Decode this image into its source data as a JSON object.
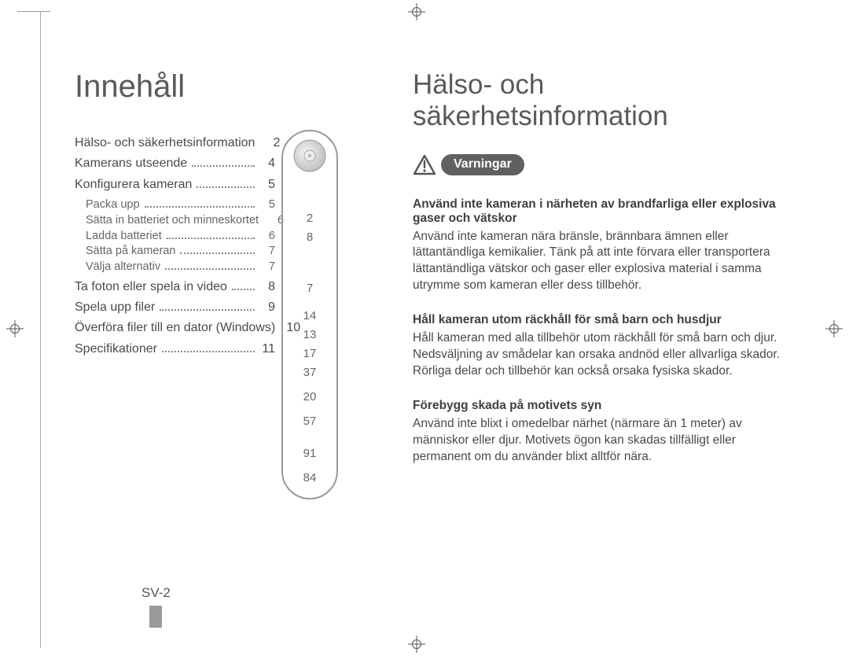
{
  "toc": {
    "title": "Innehåll",
    "items": [
      {
        "label": "Hälso- och säkerhetsinformation",
        "page": "2",
        "sub": false
      },
      {
        "label": "Kamerans utseende",
        "page": "4",
        "sub": false
      },
      {
        "label": "Konfigurera kameran",
        "page": "5",
        "sub": false
      },
      {
        "label": "Packa upp",
        "page": "5",
        "sub": true
      },
      {
        "label": "Sätta in batteriet och minneskortet",
        "page": "6",
        "sub": true
      },
      {
        "label": "Ladda batteriet",
        "page": "6",
        "sub": true
      },
      {
        "label": "Sätta på kameran",
        "page": "7",
        "sub": true
      },
      {
        "label": "Välja alternativ",
        "page": "7",
        "sub": true
      },
      {
        "label": "Ta foton eller spela in video",
        "page": "8",
        "sub": false
      },
      {
        "label": "Spela upp filer",
        "page": "9",
        "sub": false
      },
      {
        "label": "Överföra filer till en dator (Windows)",
        "page": "10",
        "sub": false
      },
      {
        "label": "Specifikationer",
        "page": "11",
        "sub": false
      }
    ]
  },
  "thumb_index": [
    "2",
    "8",
    "7",
    "14",
    "13",
    "17",
    "37",
    "20",
    "57",
    "91",
    "84"
  ],
  "safety": {
    "title": "Hälso- och säkerhetsinformation",
    "badge_label": "Varningar",
    "blocks": [
      {
        "title": "Använd inte kameran i närheten av brandfarliga eller explosiva gaser och vätskor",
        "body": "Använd inte kameran nära bränsle, brännbara ämnen eller lättantändliga kemikalier. Tänk på att inte förvara eller transportera lättantändliga vätskor och gaser eller explosiva material i samma utrymme som kameran eller dess tillbehör."
      },
      {
        "title": "Håll kameran utom räckhåll för små barn och husdjur",
        "body": "Håll kameran med alla tillbehör utom räckhåll för små barn och djur. Nedsväljning av smådelar kan orsaka andnöd eller allvarliga skador. Rörliga delar och tillbehör kan också orsaka fysiska skador."
      },
      {
        "title": "Förebygg skada på motivets syn",
        "body": "Använd inte blixt i omedelbar närhet (närmare än 1 meter) av människor eller djur. Motivets ögon kan skadas tillfälligt eller permanent om du använder blixt alltför nära."
      }
    ]
  },
  "page_number": "SV-2"
}
